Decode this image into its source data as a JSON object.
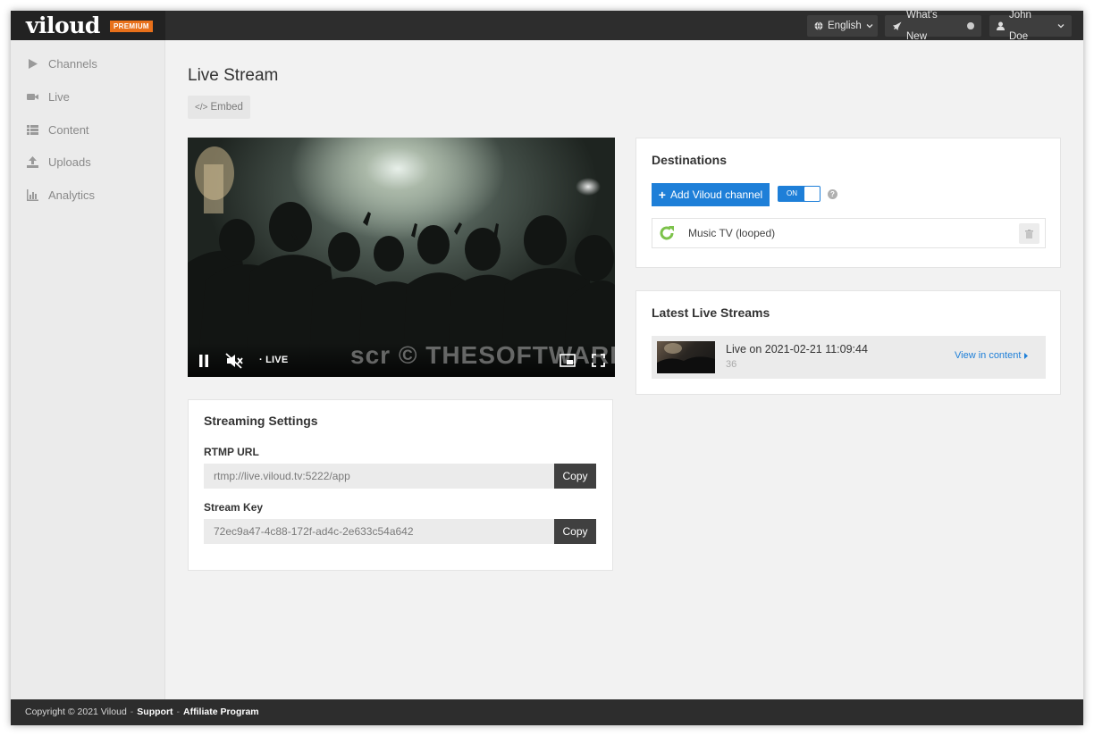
{
  "brand": {
    "logo": "viloud",
    "badge": "PREMIUM"
  },
  "topbar": {
    "language": "English",
    "whats_new": "What's New",
    "user": "John Doe"
  },
  "sidebar": {
    "items": [
      {
        "label": "Channels",
        "icon": "play-icon"
      },
      {
        "label": "Live",
        "icon": "video-camera-icon"
      },
      {
        "label": "Content",
        "icon": "grid-list-icon"
      },
      {
        "label": "Uploads",
        "icon": "upload-icon"
      },
      {
        "label": "Analytics",
        "icon": "bar-chart-icon"
      }
    ]
  },
  "main": {
    "title": "Live Stream",
    "embed_label": "Embed"
  },
  "player": {
    "live_label": "LIVE",
    "watermark": "scr © THESOFTWARE.SHOP"
  },
  "streaming_settings": {
    "title": "Streaming Settings",
    "rtmp_label": "RTMP URL",
    "rtmp_value": "rtmp://live.viloud.tv:5222/app",
    "key_label": "Stream Key",
    "key_value": "72ec9a47-4c88-172f-ad4c-2e633c54a642",
    "copy_label": "Copy"
  },
  "destinations": {
    "title": "Destinations",
    "add_button": "Add Viloud channel",
    "toggle_label": "ON",
    "help": "?",
    "items": [
      {
        "name": "Music TV (looped)"
      }
    ]
  },
  "latest_streams": {
    "title": "Latest Live Streams",
    "items": [
      {
        "title": "Live on 2021-02-21 11:09:44",
        "count": "36",
        "link": "View in content"
      }
    ]
  },
  "footer": {
    "copyright": "Copyright © 2021 Viloud",
    "support": "Support",
    "affiliate": "Affiliate Program",
    "separator": "-"
  },
  "colors": {
    "accent": "#1e7fd8",
    "badge": "#e8701a",
    "topbar": "#2d2d2d",
    "refresh_icon": "#7cc24a"
  }
}
